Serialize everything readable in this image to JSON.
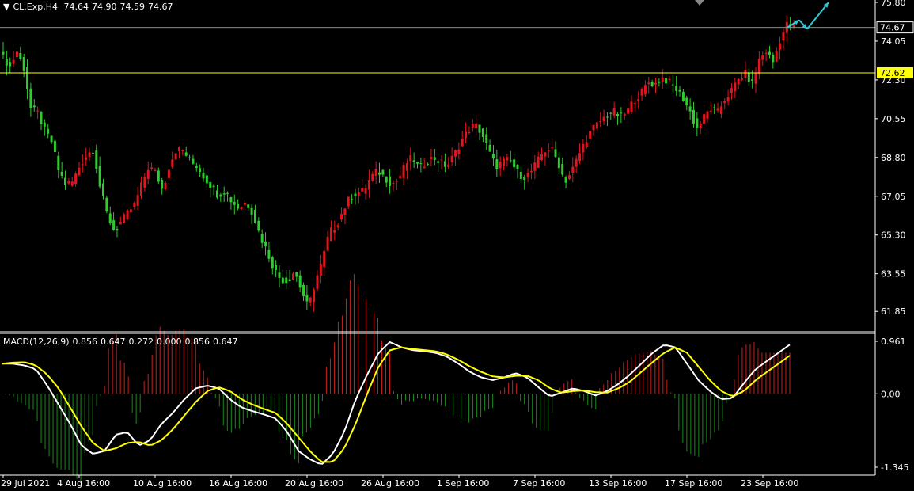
{
  "header": {
    "symbol": "CL.Exp,H4",
    "open": "74.64",
    "high": "74.90",
    "low": "74.59",
    "close": "74.67"
  },
  "macd_header": {
    "name": "MACD(12,26,9)",
    "values": [
      "0.856",
      "0.647",
      "0.272",
      "0.000",
      "0.856",
      "0.647"
    ]
  },
  "colors": {
    "background": "#000000",
    "bull_candle": "#e0151e",
    "bear_candle": "#2ecc2e",
    "price_line": "#8a8a8a",
    "level_line": "#ffff00",
    "macd_main": "#ffffff",
    "macd_signal": "#ffff00",
    "hist_up": "#c82020",
    "hist_down": "#1a8a1a",
    "arrow": "#30c8d8",
    "axis_text": "#ffffff"
  },
  "chart_data": [
    {
      "type": "candlestick",
      "title": "CL.Exp,H4",
      "ylim": [
        61.0,
        75.8
      ],
      "y_ticks": [
        "75.80",
        "74.05",
        "72.30",
        "70.55",
        "68.80",
        "67.05",
        "65.30",
        "63.55",
        "61.85"
      ],
      "x_ticks": [
        "29 Jul 2021",
        "4 Aug 16:00",
        "10 Aug 16:00",
        "16 Aug 16:00",
        "20 Aug 16:00",
        "26 Aug 16:00",
        "1 Sep 16:00",
        "7 Sep 16:00",
        "13 Sep 16:00",
        "17 Sep 16:00",
        "23 Sep 16:00"
      ],
      "current_price": "74.67",
      "level": "72.62",
      "close_path": [
        73.3,
        72.9,
        73.6,
        72.8,
        71.0,
        70.8,
        70.0,
        69.5,
        68.2,
        67.6,
        67.7,
        68.4,
        68.9,
        69.2,
        67.4,
        66.2,
        65.5,
        65.9,
        66.3,
        66.7,
        67.6,
        68.4,
        68.1,
        67.3,
        68.5,
        69.2,
        69.1,
        68.6,
        68.4,
        67.9,
        67.5,
        67.1,
        67.3,
        66.8,
        66.5,
        66.8,
        66.3,
        65.3,
        64.6,
        63.8,
        63.3,
        63.2,
        63.7,
        62.8,
        62.0,
        63.2,
        64.1,
        65.4,
        65.7,
        66.4,
        67.0,
        67.2,
        67.3,
        67.9,
        68.2,
        67.9,
        67.6,
        67.8,
        68.5,
        68.8,
        68.3,
        68.6,
        68.8,
        68.6,
        68.4,
        68.9,
        69.5,
        70.0,
        70.3,
        69.9,
        69.1,
        68.4,
        68.6,
        68.7,
        68.2,
        67.9,
        68.1,
        68.6,
        69.1,
        69.2,
        68.6,
        67.7,
        68.2,
        68.9,
        69.6,
        70.1,
        70.4,
        70.7,
        70.9,
        70.6,
        70.9,
        71.4,
        71.7,
        72.2,
        72.1,
        72.4,
        72.2,
        71.9,
        71.5,
        70.9,
        70.1,
        70.6,
        71.0,
        70.8,
        71.4,
        71.8,
        72.3,
        72.6,
        72.1,
        73.2,
        73.6,
        73.1,
        74.1,
        74.8,
        74.67
      ],
      "arrow_forecast": [
        [
          74.67,
          75.0
        ],
        [
          75.0,
          74.6
        ],
        [
          74.6,
          75.8
        ]
      ]
    },
    {
      "type": "macd",
      "title": "MACD(12,26,9)",
      "params": [
        12,
        26,
        9
      ],
      "ylim": [
        -1.345,
        0.961
      ],
      "y_ticks": [
        "0.961",
        "0.00",
        "-1.345"
      ],
      "main_path": [
        0.55,
        0.55,
        0.52,
        0.45,
        0.15,
        -0.2,
        -0.55,
        -0.95,
        -1.1,
        -1.05,
        -0.75,
        -0.7,
        -0.95,
        -0.85,
        -0.55,
        -0.35,
        -0.1,
        0.1,
        0.15,
        0.1,
        -0.1,
        -0.25,
        -0.32,
        -0.38,
        -0.45,
        -0.7,
        -1.05,
        -1.2,
        -1.3,
        -1.1,
        -0.7,
        -0.1,
        0.35,
        0.75,
        0.95,
        0.85,
        0.8,
        0.78,
        0.75,
        0.68,
        0.55,
        0.4,
        0.3,
        0.25,
        0.3,
        0.38,
        0.3,
        0.12,
        -0.05,
        0.02,
        0.1,
        0.05,
        -0.03,
        0.05,
        0.18,
        0.35,
        0.55,
        0.75,
        0.9,
        0.85,
        0.55,
        0.25,
        0.05,
        -0.1,
        -0.08,
        0.2,
        0.45,
        0.6,
        0.75,
        0.9
      ],
      "signal_path": [
        0.55,
        0.57,
        0.58,
        0.52,
        0.35,
        0.1,
        -0.25,
        -0.6,
        -0.9,
        -1.05,
        -1.0,
        -0.9,
        -0.88,
        -0.95,
        -0.85,
        -0.65,
        -0.4,
        -0.15,
        0.05,
        0.12,
        0.05,
        -0.1,
        -0.2,
        -0.28,
        -0.35,
        -0.55,
        -0.8,
        -1.05,
        -1.25,
        -1.25,
        -1.0,
        -0.55,
        0.0,
        0.5,
        0.8,
        0.85,
        0.82,
        0.8,
        0.78,
        0.72,
        0.62,
        0.5,
        0.4,
        0.32,
        0.3,
        0.33,
        0.33,
        0.25,
        0.1,
        0.02,
        0.05,
        0.06,
        0.03,
        0.02,
        0.1,
        0.22,
        0.4,
        0.58,
        0.75,
        0.85,
        0.75,
        0.5,
        0.25,
        0.05,
        -0.05,
        0.05,
        0.25,
        0.4,
        0.55,
        0.7
      ]
    }
  ]
}
